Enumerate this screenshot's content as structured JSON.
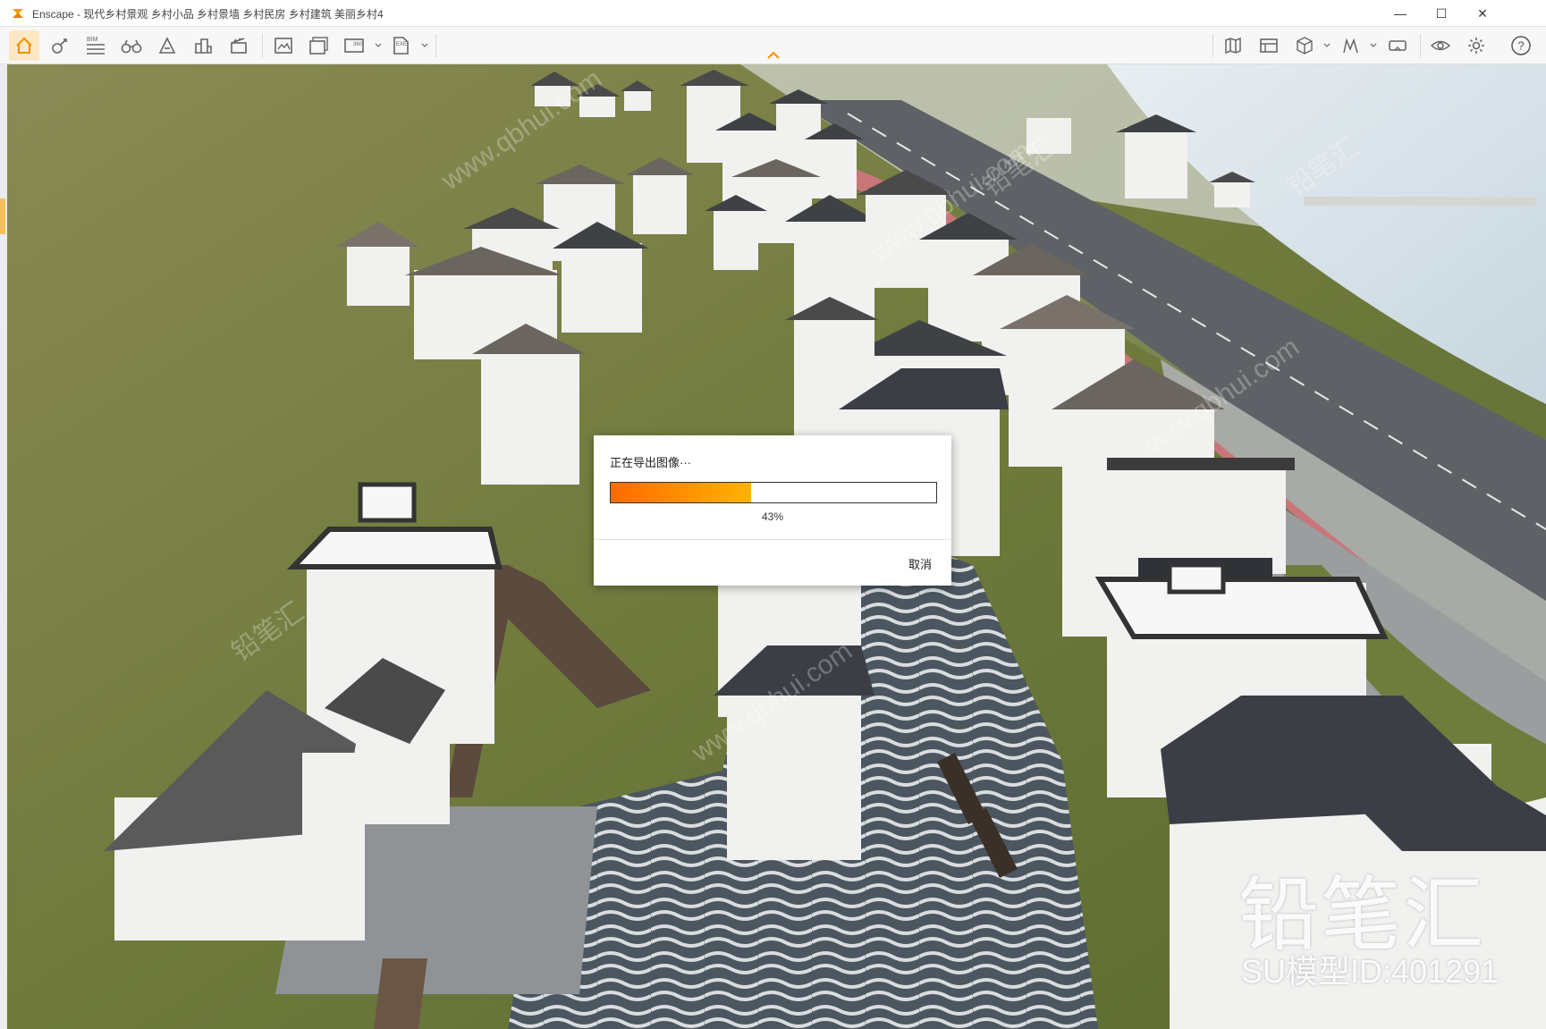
{
  "window": {
    "title": "Enscape - 现代乡村景观 乡村小品 乡村景墙 乡村民房 乡村建筑 美丽乡村4",
    "minimize_glyph": "—",
    "maximize_glyph": "☐",
    "close_glyph": "✕"
  },
  "toolbar": {
    "bim_label": "BIM",
    "icons_left": [
      "home-icon",
      "visual-settings-icon",
      "bim-list-icon",
      "binoculars-icon",
      "material-editor-icon",
      "asset-library-icon",
      "video-editor-icon",
      "screenshot-icon",
      "batch-render-icon",
      "panorama-icon",
      "exe-export-icon"
    ],
    "icons_right": [
      "map-icon",
      "views-icon",
      "cube-icon",
      "sketch-icon",
      "vr-headset-icon",
      "visibility-icon",
      "settings-icon",
      "help-icon"
    ],
    "help_glyph": "?"
  },
  "dialog": {
    "title": "正在导出图像···",
    "progress": 43,
    "progress_label": "43%",
    "cancel_label": "取消"
  },
  "watermark": {
    "brand": "铅笔汇",
    "model_id": "SU模型ID:401291",
    "diagonal_text": "www.qbhui.com",
    "diagonal_brand": "铅笔汇"
  },
  "colors": {
    "accent": "#ff8c00",
    "home_highlight": "#fde7c4",
    "progress_start": "#ff6a00",
    "progress_end": "#ffb300"
  }
}
